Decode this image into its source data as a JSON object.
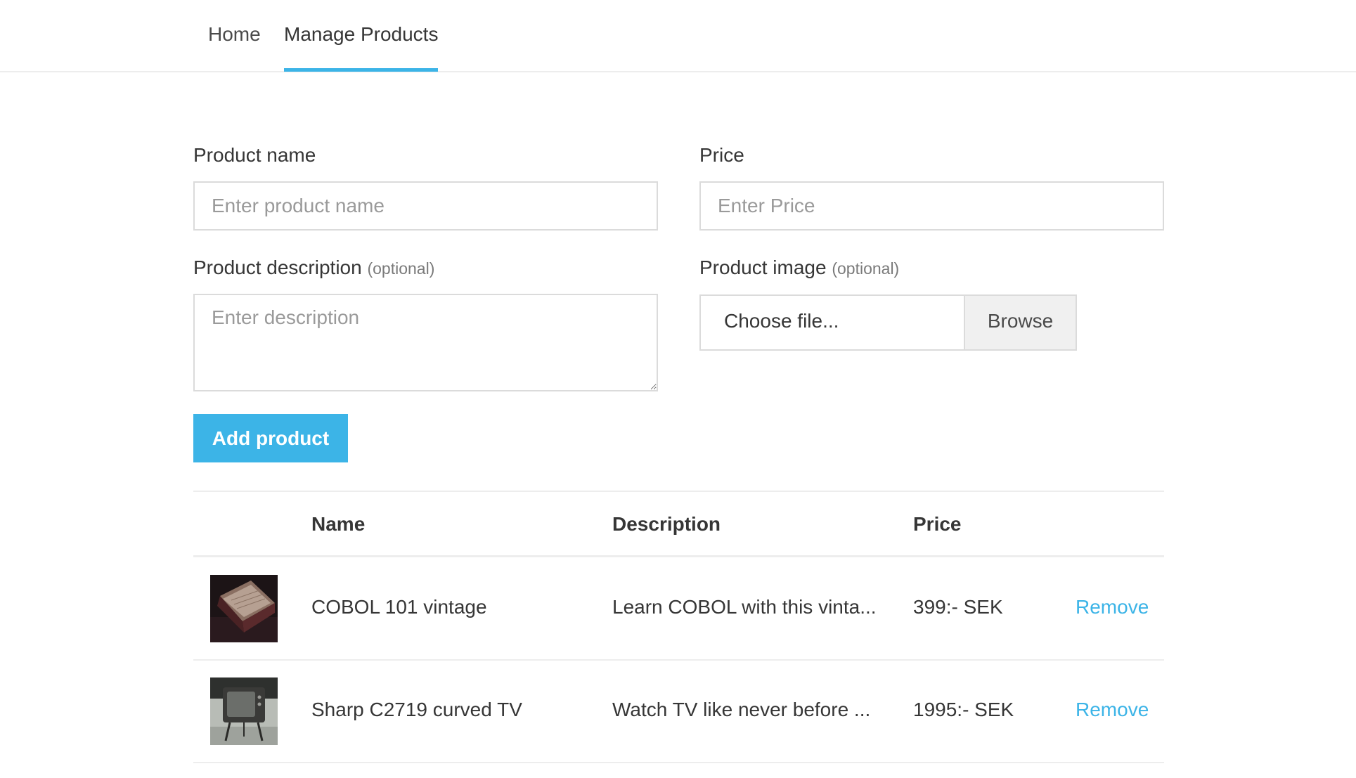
{
  "nav": {
    "tabs": [
      {
        "label": "Home",
        "active": false
      },
      {
        "label": "Manage Products",
        "active": true
      }
    ]
  },
  "form": {
    "product_name": {
      "label": "Product name",
      "placeholder": "Enter product name",
      "value": ""
    },
    "price": {
      "label": "Price",
      "placeholder": "Enter Price",
      "value": ""
    },
    "description": {
      "label": "Product description",
      "optional": "(optional)",
      "placeholder": "Enter description",
      "value": ""
    },
    "image": {
      "label": "Product image",
      "optional": "(optional)",
      "file_text": "Choose file...",
      "browse_label": "Browse"
    },
    "submit_label": "Add product"
  },
  "table": {
    "headers": [
      "Name",
      "Description",
      "Price"
    ],
    "rows": [
      {
        "name": "COBOL 101 vintage",
        "description": "Learn COBOL with this vinta...",
        "price": "399:- SEK",
        "action": "Remove",
        "thumb": "old-book"
      },
      {
        "name": "Sharp C2719 curved TV",
        "description": "Watch TV like never before ...",
        "price": "1995:- SEK",
        "action": "Remove",
        "thumb": "vintage-tv"
      }
    ]
  },
  "colors": {
    "accent": "#3cb4e7",
    "text": "#363636",
    "border": "#dbdbdb"
  }
}
